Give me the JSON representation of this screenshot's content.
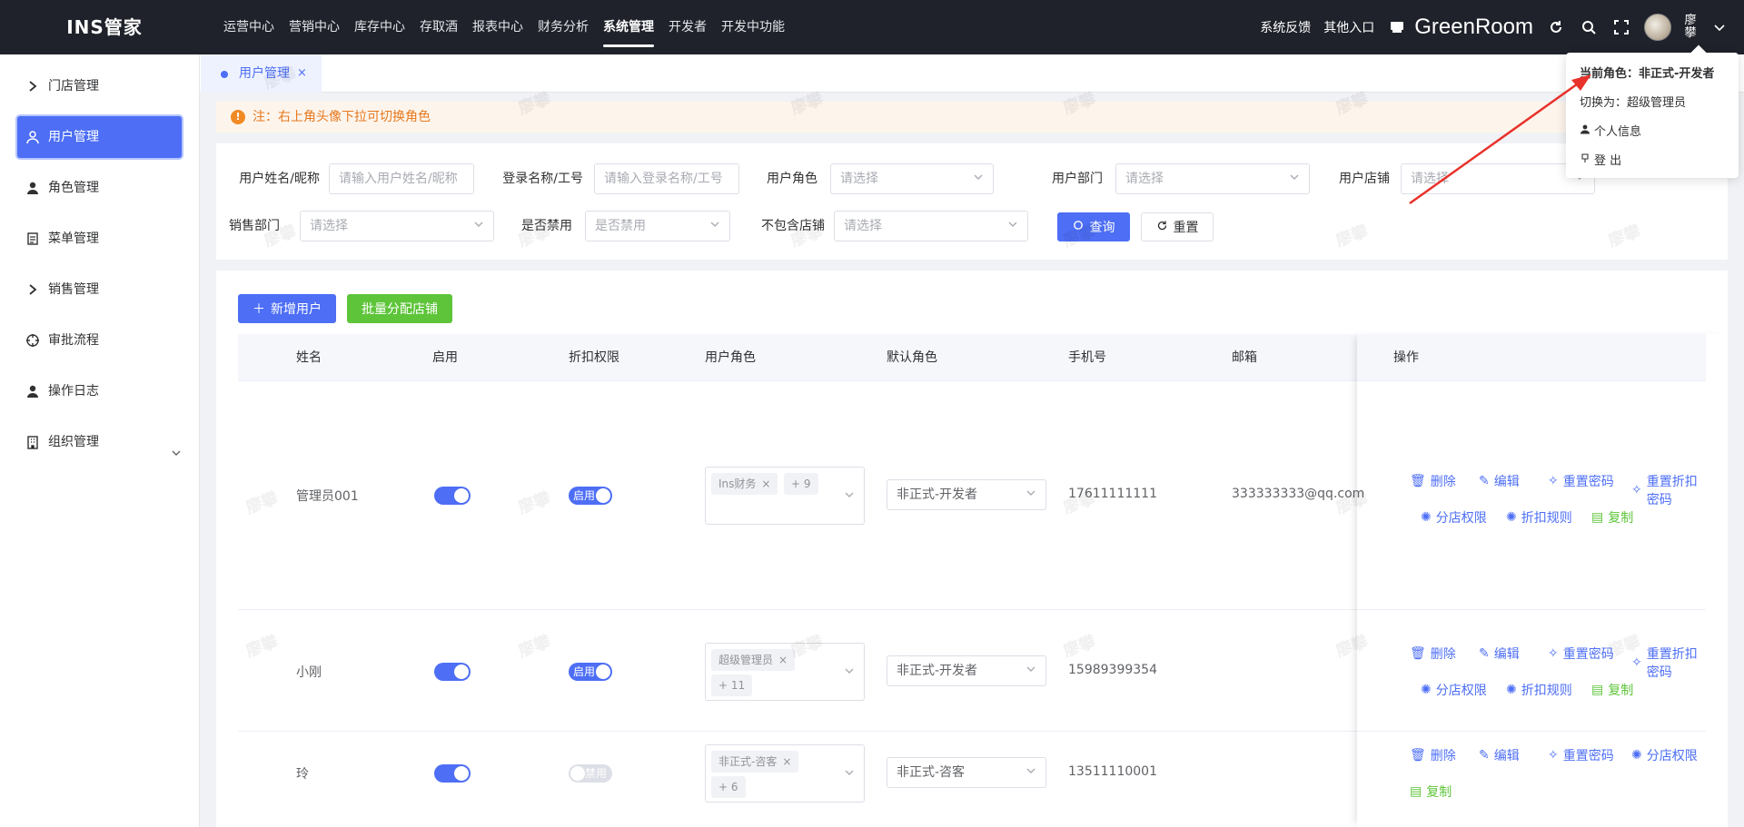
{
  "app": {
    "logo": "INS管家"
  },
  "topnav": [
    "运营中心",
    "营销中心",
    "库存中心",
    "存取酒",
    "报表中心",
    "财务分析",
    "系统管理",
    "开发者",
    "开发中功能"
  ],
  "topnav_active": 6,
  "topright": {
    "feedback": "系统反馈",
    "other_entry": "其他入口",
    "store_name": "GreenRoom",
    "user_name": "廖攀"
  },
  "sidebar": [
    {
      "label": "门店管理",
      "icon": "chevron-right-icon"
    },
    {
      "label": "用户管理",
      "icon": "user-icon",
      "active": true
    },
    {
      "label": "角色管理",
      "icon": "user-icon"
    },
    {
      "label": "菜单管理",
      "icon": "document-icon"
    },
    {
      "label": "销售管理",
      "icon": "chevron-right-icon"
    },
    {
      "label": "审批流程",
      "icon": "target-icon"
    },
    {
      "label": "操作日志",
      "icon": "user-icon"
    },
    {
      "label": "组织管理",
      "icon": "building-icon"
    }
  ],
  "tab": {
    "label": "用户管理",
    "close": "×"
  },
  "notice": "注：右上角头像下拉可切换角色",
  "filters": {
    "name_label": "用户姓名/昵称",
    "name_placeholder": "请输入用户姓名/昵称",
    "login_label": "登录名称/工号",
    "login_placeholder": "请输入登录名称/工号",
    "role_label": "用户角色",
    "role_placeholder": "请选择",
    "dept_label": "用户部门",
    "dept_placeholder": "请选择",
    "store_label": "用户店铺",
    "store_placeholder": "请选择",
    "sales_label": "销售部门",
    "sales_placeholder": "请选择",
    "disabled_label": "是否禁用",
    "disabled_placeholder": "是否禁用",
    "exclude_label": "不包含店铺",
    "exclude_placeholder": "请选择",
    "search_btn": "查询",
    "reset_btn": "重置"
  },
  "actions": {
    "add_user": "新增用户",
    "batch_assign": "批量分配店铺"
  },
  "table": {
    "headers": [
      "姓名",
      "启用",
      "折扣权限",
      "用户角色",
      "默认角色",
      "手机号",
      "邮箱",
      "操作"
    ],
    "rows": [
      {
        "name": "管理员001",
        "enabled": true,
        "discount": "启用",
        "discount_on": true,
        "role_tags": [
          "Ins财务",
          "+ 9"
        ],
        "default_role": "非正式-开发者",
        "phone": "17611111111",
        "email": "333333333@qq.com",
        "ops": [
          "删除",
          "编辑",
          "重置密码",
          "重置折扣密码",
          "分店权限",
          "折扣规则",
          "复制"
        ]
      },
      {
        "name": "小刚",
        "enabled": true,
        "discount": "启用",
        "discount_on": true,
        "role_tags": [
          "超级管理员",
          "+ 11"
        ],
        "default_role": "非正式-开发者",
        "phone": "15989399354",
        "email": "",
        "ops": [
          "删除",
          "编辑",
          "重置密码",
          "重置折扣密码",
          "分店权限",
          "折扣规则",
          "复制"
        ]
      },
      {
        "name": "玲",
        "enabled": true,
        "discount": "禁用",
        "discount_on": false,
        "role_tags": [
          "非正式-咨客",
          "+ 6"
        ],
        "default_role": "非正式-咨客",
        "phone": "13511110001",
        "email": "",
        "ops": [
          "删除",
          "编辑",
          "重置密码",
          "分店权限",
          "复制"
        ]
      }
    ]
  },
  "dropdown": {
    "current_role": "当前角色：非正式-开发者",
    "switch_to": "切换为：超级管理员",
    "profile": "个人信息",
    "logout": "登 出"
  },
  "watermark": "廖攀",
  "colors": {
    "primary": "#4d6ef5",
    "success": "#5ec53a",
    "topbar": "#1f222a",
    "warning": "#e6781e",
    "arrow": "#e8312a"
  }
}
